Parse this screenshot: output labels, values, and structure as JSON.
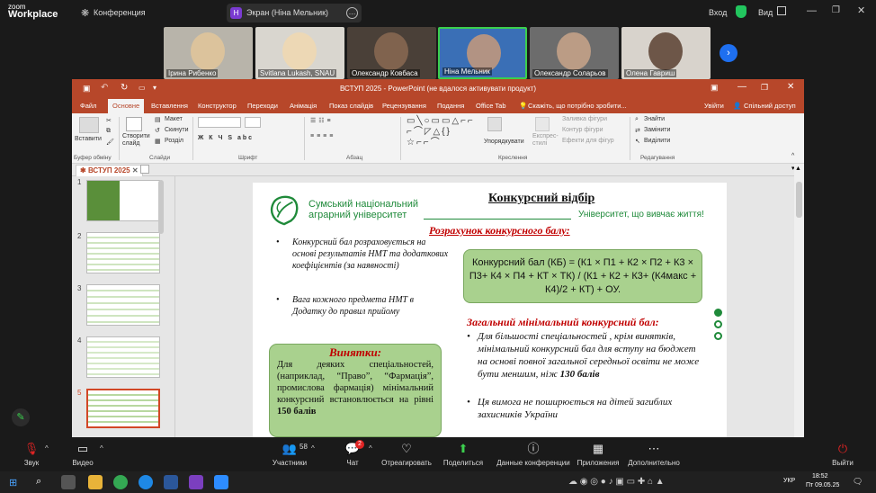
{
  "zoom": {
    "logo_top": "zoom",
    "logo_bottom": "Workplace",
    "conference": "Конференция",
    "screen_badge": "Н",
    "screen_label": "Экран (Ніна Мельник)",
    "signin": "Вход",
    "view": "Вид",
    "participants": [
      {
        "name": "Ірина Рибенко"
      },
      {
        "name": "Svitlana Lukash, SNAU"
      },
      {
        "name": "Олександр Ковбаса"
      },
      {
        "name": "Ніна Мельник"
      },
      {
        "name": "Олександр Соларьов"
      },
      {
        "name": "Олена Гавриш"
      }
    ],
    "bottom": {
      "sound": "Звук",
      "video": "Видео",
      "participants": "Участники",
      "participants_count": "58",
      "chat": "Чат",
      "chat_badge": "2",
      "react": "Отреагировать",
      "share": "Поделиться",
      "data": "Данные конференции",
      "apps": "Приложения",
      "more": "Дополнительно",
      "leave": "Выйти"
    }
  },
  "ppt": {
    "title": "ВСТУП 2025 - PowerPoint (не вдалося активувати продукт)",
    "tabs": [
      "Файл",
      "Основне",
      "Вставлення",
      "Конструктор",
      "Переходи",
      "Анімація",
      "Показ слайдів",
      "Рецензування",
      "Подання",
      "Office Tab"
    ],
    "tell_me": "Скажіть, що потрібно зробити...",
    "signin": "Увійти",
    "share": "Спільний доступ",
    "ribbon": {
      "paste": "Вставити",
      "clipboard": "Буфер обміну",
      "new_slide": "Створити слайд",
      "layout": "Макет",
      "reset": "Скинути",
      "section": "Розділ",
      "slides": "Слайди",
      "font": "Шрифт",
      "paragraph": "Абзац",
      "arrange": "Упорядкувати",
      "quick_styles": "Експрес-стилі",
      "drawing": "Креслення",
      "fill": "Заливка фігури",
      "outline": "Контур фігури",
      "effects": "Ефекти для фігур",
      "find": "Знайти",
      "replace": "Замінити",
      "select": "Виділити",
      "editing": "Редагування",
      "font_style_letters": "Ж К Ч S abc"
    },
    "doc_tab": "ВСТУП 2025",
    "thumb_numbers": [
      "1",
      "2",
      "3",
      "4",
      "5"
    ]
  },
  "slide": {
    "university_line1": "Сумський національний",
    "university_line2": "аграрний університет",
    "heading": "Конкурсний відбір",
    "motto": "Університет, що вивчає життя!",
    "subheading": "Розрахунок конкурсного балу:",
    "bullet1": "Конкурсний бал розраховується на основі результатів НМТ та додаткових коефіцієнтів (за наявності)",
    "bullet2": "Вага кожного предмета НМТ в Додатку до правил прийому",
    "formula": "Конкурсний бал (КБ)  = (К1 × П1 + К2 × П2 + К3 × П3+ К4 × П4 + КТ × ТК) / (К1 + К2 + К3+ (К4макс + К4)/2 + КТ) + ОУ.",
    "exceptions_title": "Винятки:",
    "exceptions_text": "Для деяких спеціальностей, (наприклад, “Право”, “Фармація”, промислова фармація) мінімальний конкурсний встановлюється на рівні",
    "exceptions_bold": "150 балів",
    "min_title": "Загальний  мінімальний конкурсний бал:",
    "min_bullet1": "Для більшості спеціальностей , крім винятків, мінімальний конкурсний бал для вступу на бюджет на основі повної загальної середньої освіти не може бути меншим, ніж",
    "min_bullet1_bold": "130 балів",
    "min_bullet2": "Ця вимога не поширюється на дітей загиблих захисників України"
  },
  "taskbar": {
    "lang": "УКР",
    "time": "18:52",
    "date": "Пт 09.05.25"
  },
  "colors": {
    "ppt_accent": "#b7472a",
    "snau_green": "#1f8a3a",
    "box_green": "#a9d18e",
    "red_text": "#c00000",
    "zoom_blue": "#1e6ff0"
  }
}
